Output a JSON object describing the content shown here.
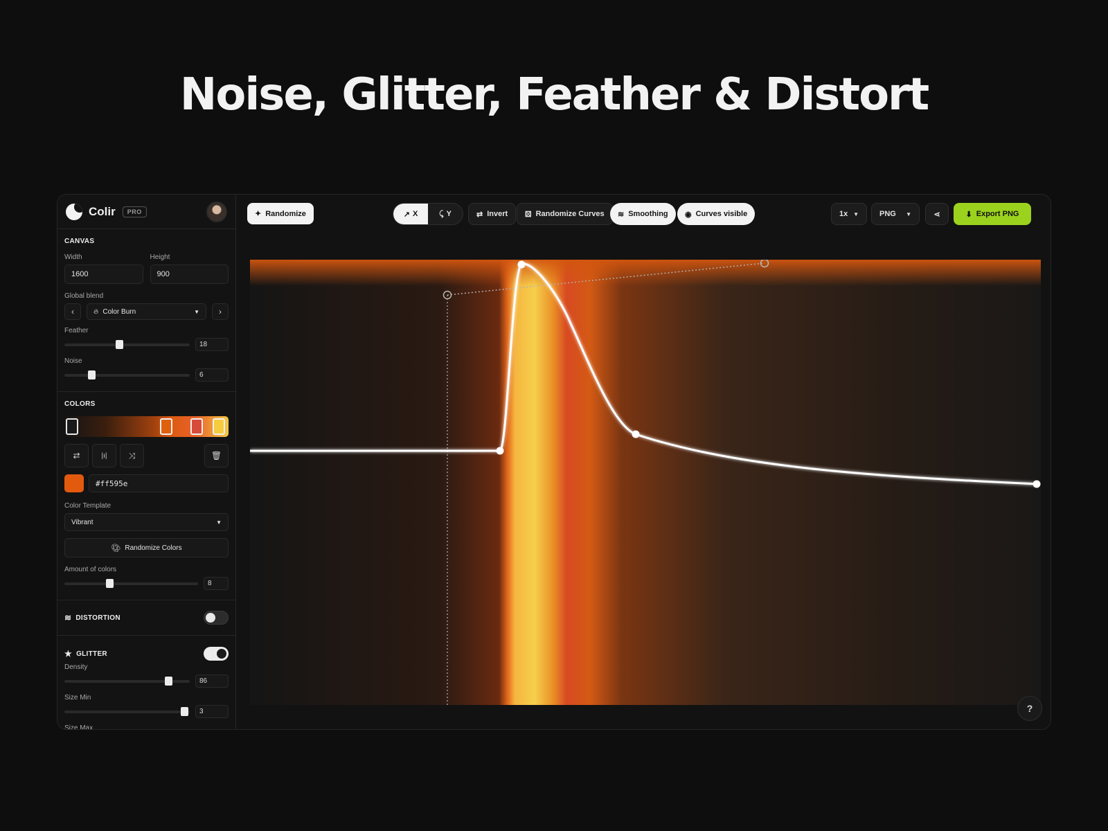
{
  "hero": {
    "title": "Noise, Glitter, Feather & Distort"
  },
  "brand": {
    "name": "Colir",
    "badge": "PRO"
  },
  "canvas": {
    "title": "CANVAS",
    "width_label": "Width",
    "width_value": "1600",
    "height_label": "Height",
    "height_value": "900",
    "blend_label": "Global blend",
    "blend_value": "Color Burn",
    "feather_label": "Feather",
    "feather_value": "18",
    "feather_level": 0.43,
    "noise_label": "Noise",
    "noise_value": "6",
    "noise_level": 0.22
  },
  "colors": {
    "title": "COLORS",
    "hex_value": "#ff595e",
    "swatch_color": "#e25a0e",
    "template_label": "Color Template",
    "template_value": "Vibrant",
    "randomize_label": "Randomize Colors",
    "amount_label": "Amount of colors",
    "amount_value": "8",
    "amount_level": 0.35
  },
  "distortion": {
    "title": "DISTORTION",
    "enabled": false
  },
  "glitter": {
    "title": "GLITTER",
    "enabled": true,
    "density_label": "Density",
    "density_value": "86",
    "density_level": 0.84,
    "size_min_label": "Size Min",
    "size_min_value": "3",
    "size_min_level": 0.97,
    "size_max_label": "Size Max"
  },
  "toolbar": {
    "randomize": "Randomize",
    "axis_x": "X",
    "axis_y": "Y",
    "invert": "Invert",
    "randomize_curves": "Randomize Curves",
    "smoothing": "Smoothing",
    "curves_visible": "Curves visible",
    "scale": "1x",
    "format": "PNG",
    "export": "Export PNG"
  },
  "accent": "#9bd21e"
}
